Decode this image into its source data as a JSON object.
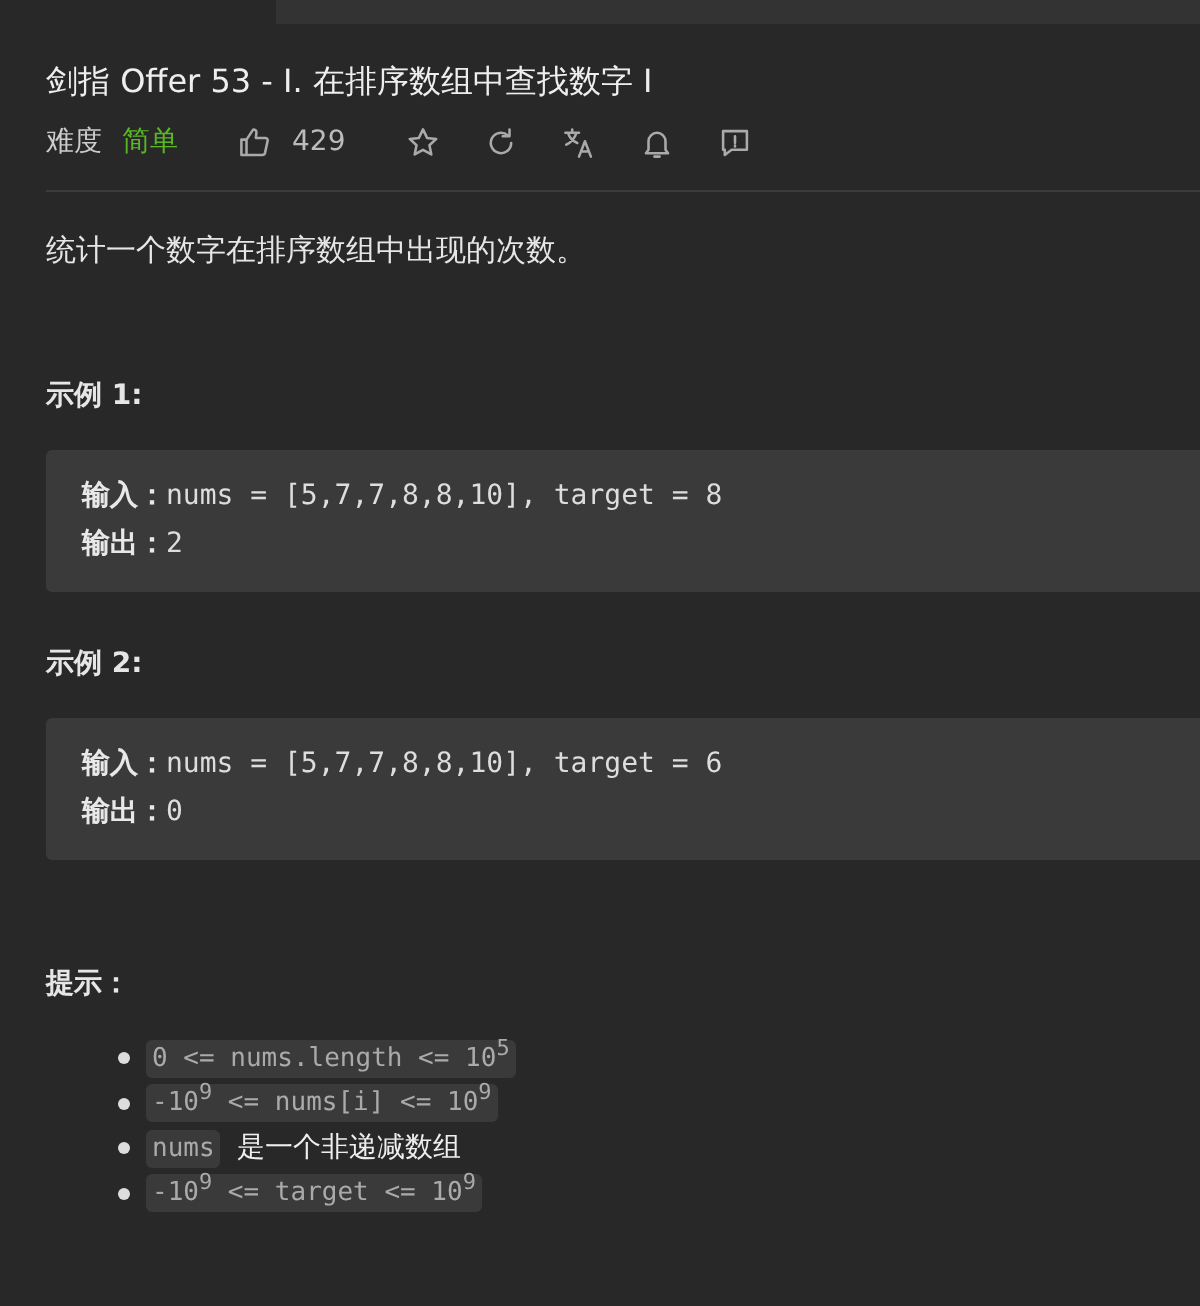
{
  "title": "剑指 Offer 53 - I. 在排序数组中查找数字 I",
  "meta": {
    "difficulty_label": "难度",
    "difficulty": "简单",
    "likes": "429"
  },
  "description": "统计一个数字在排序数组中出现的次数。",
  "examples": [
    {
      "heading": "示例 1:",
      "lines": [
        "**输入：**nums = [5,7,7,8,8,10], target = 8",
        "**输出：**2"
      ]
    },
    {
      "heading": "示例 2:",
      "lines": [
        "**输入：**nums = [5,7,7,8,8,10], target = 6",
        "**输出：**0"
      ]
    }
  ],
  "hints": {
    "heading": "提示：",
    "items": [
      {
        "code": "0 <= nums.length <= 10$^{5}$"
      },
      {
        "code": "-10$^{9}$  <= nums[i]  <= 10$^{9}$"
      },
      {
        "code": "nums",
        "text": "是一个非递减数组"
      },
      {
        "code": "-10$^{9}$  <= target  <= 10$^{9}$"
      }
    ]
  }
}
